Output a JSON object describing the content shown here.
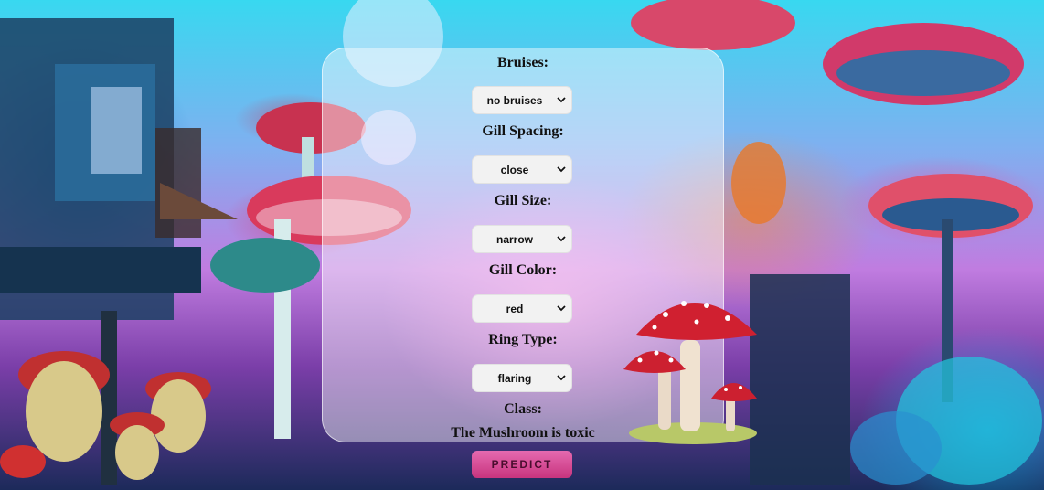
{
  "form": {
    "fields": [
      {
        "label": "Bruises:",
        "value": "no bruises"
      },
      {
        "label": "Gill Spacing:",
        "value": "close"
      },
      {
        "label": "Gill Size:",
        "value": "narrow"
      },
      {
        "label": "Gill Color:",
        "value": "red"
      },
      {
        "label": "Ring Type:",
        "value": "flaring"
      }
    ],
    "class_label": "Class:",
    "result_text": "The Mushroom is toxic",
    "predict_label": "PREDICT"
  },
  "icons": {
    "select_arrow": "chevron-down-icon",
    "background": "fantasy-mushroom-forest-illustration",
    "mushroom": "red-spotted-mushroom-illustration"
  },
  "colors": {
    "predict_button": "#d94d98",
    "panel": "rgba(255,255,255,0.45)"
  }
}
